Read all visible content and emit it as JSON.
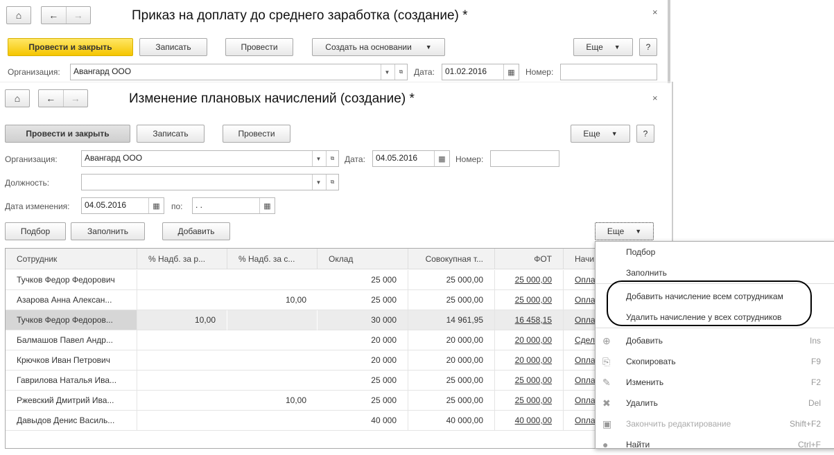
{
  "window1": {
    "title": "Приказ на доплату до среднего заработка (создание) *",
    "close": "×",
    "buttons": {
      "post_close": "Провести и закрыть",
      "save": "Записать",
      "post": "Провести",
      "create_based": "Создать на основании",
      "more": "Еще",
      "help": "?"
    },
    "org_label": "Организация:",
    "org_value": "Авангард ООО",
    "date_label": "Дата:",
    "date_value": "01.02.2016",
    "number_label": "Номер:",
    "number_value": ""
  },
  "window2": {
    "title": "Изменение плановых начислений (создание) *",
    "close": "×",
    "buttons": {
      "post_close": "Провести и закрыть",
      "save": "Записать",
      "post": "Провести",
      "more": "Еще",
      "help": "?"
    },
    "org_label": "Организация:",
    "org_value": "Авангард ООО",
    "date_label": "Дата:",
    "date_value": "04.05.2016",
    "number_label": "Номер:",
    "number_value": "",
    "position_label": "Должность:",
    "position_value": "",
    "change_date_label": "Дата изменения:",
    "change_date_value": "04.05.2016",
    "to_label": "по:",
    "to_value": " .  . ",
    "table_buttons": {
      "select": "Подбор",
      "fill": "Заполнить",
      "add": "Добавить",
      "more": "Еще"
    }
  },
  "table": {
    "columns": [
      "Сотрудник",
      "%  Надб. за р...",
      "%  Надб. за с...",
      "Оклад",
      "Совокупная т...",
      "ФОТ",
      "Начи"
    ],
    "rows": [
      [
        "Тучков Федор Федорович",
        "",
        "",
        "25 000",
        "25 000,00",
        "25 000,00",
        "Опла"
      ],
      [
        "Азарова Анна Алексан...",
        "",
        "10,00",
        "25 000",
        "25 000,00",
        "25 000,00",
        "Опла"
      ],
      [
        "Тучков Федор Федоров...",
        "10,00",
        "",
        "30 000",
        "14 961,95",
        "16 458,15",
        "Опла"
      ],
      [
        "Балмашов Павел Андр...",
        "",
        "",
        "20 000",
        "20 000,00",
        "20 000,00",
        "Сдел"
      ],
      [
        "Крючков Иван Петрович",
        "",
        "",
        "20 000",
        "20 000,00",
        "20 000,00",
        "Опла"
      ],
      [
        "Гаврилова Наталья Ива...",
        "",
        "",
        "25 000",
        "25 000,00",
        "25 000,00",
        "Опла"
      ],
      [
        "Ржевский Дмитрий Ива...",
        "",
        "10,00",
        "25 000",
        "25 000,00",
        "25 000,00",
        "Опла"
      ],
      [
        "Давыдов Денис Василь...",
        "",
        "",
        "40 000",
        "40 000,00",
        "40 000,00",
        "Опла"
      ]
    ]
  },
  "menu": {
    "items": [
      {
        "label": "Подбор",
        "shortcut": ""
      },
      {
        "label": "Заполнить",
        "shortcut": ""
      },
      {
        "label": "Добавить начисление всем сотрудникам",
        "shortcut": ""
      },
      {
        "label": "Удалить начисление у всех сотрудников",
        "shortcut": ""
      },
      {
        "label": "Добавить",
        "shortcut": "Ins"
      },
      {
        "label": "Скопировать",
        "shortcut": "F9"
      },
      {
        "label": "Изменить",
        "shortcut": "F2"
      },
      {
        "label": "Удалить",
        "shortcut": "Del"
      },
      {
        "label": "Закончить редактирование",
        "shortcut": "Shift+F2"
      },
      {
        "label": "Найти",
        "shortcut": "Ctrl+F"
      }
    ]
  }
}
